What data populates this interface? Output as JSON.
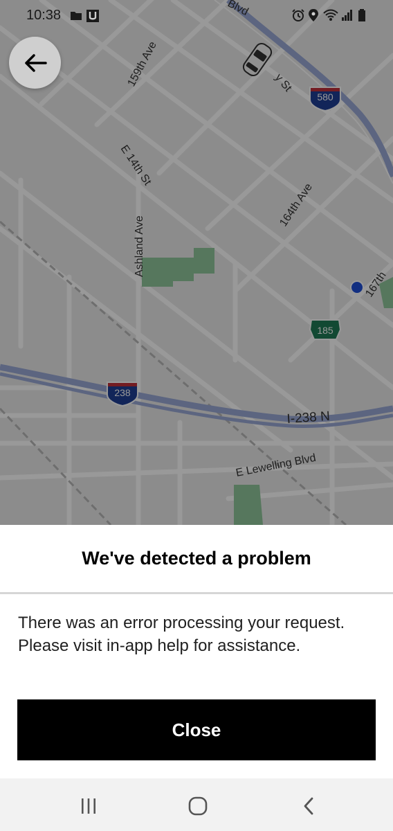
{
  "status_bar": {
    "time": "10:38",
    "left_icons": [
      "folder-icon",
      "u-app-icon"
    ],
    "right_icons": [
      "alarm-icon",
      "location-icon",
      "wifi-icon",
      "signal-icon",
      "battery-icon"
    ]
  },
  "map": {
    "street_labels": [
      "159th Ave",
      "E 14th St",
      "Ashland Ave",
      "164th Ave",
      "167th",
      "I-238 N",
      "E Lewelling Blvd",
      "Blvd",
      "y St"
    ],
    "highway_shields": [
      "580",
      "238",
      "185"
    ],
    "colors": {
      "road": "#ffffff",
      "highway": "#9aa9d6",
      "park": "#8fc79c",
      "location_dot": "#1e4fd8",
      "interstate_shield": "#1f3f94",
      "state_shield": "#1f7a56"
    }
  },
  "dialog": {
    "title": "We've detected a problem",
    "message": "There was an error processing your request. Please visit in-app help for assistance.",
    "close_label": "Close"
  },
  "nav_bar": {
    "buttons": [
      "recent-apps-icon",
      "home-icon",
      "back-icon"
    ]
  }
}
